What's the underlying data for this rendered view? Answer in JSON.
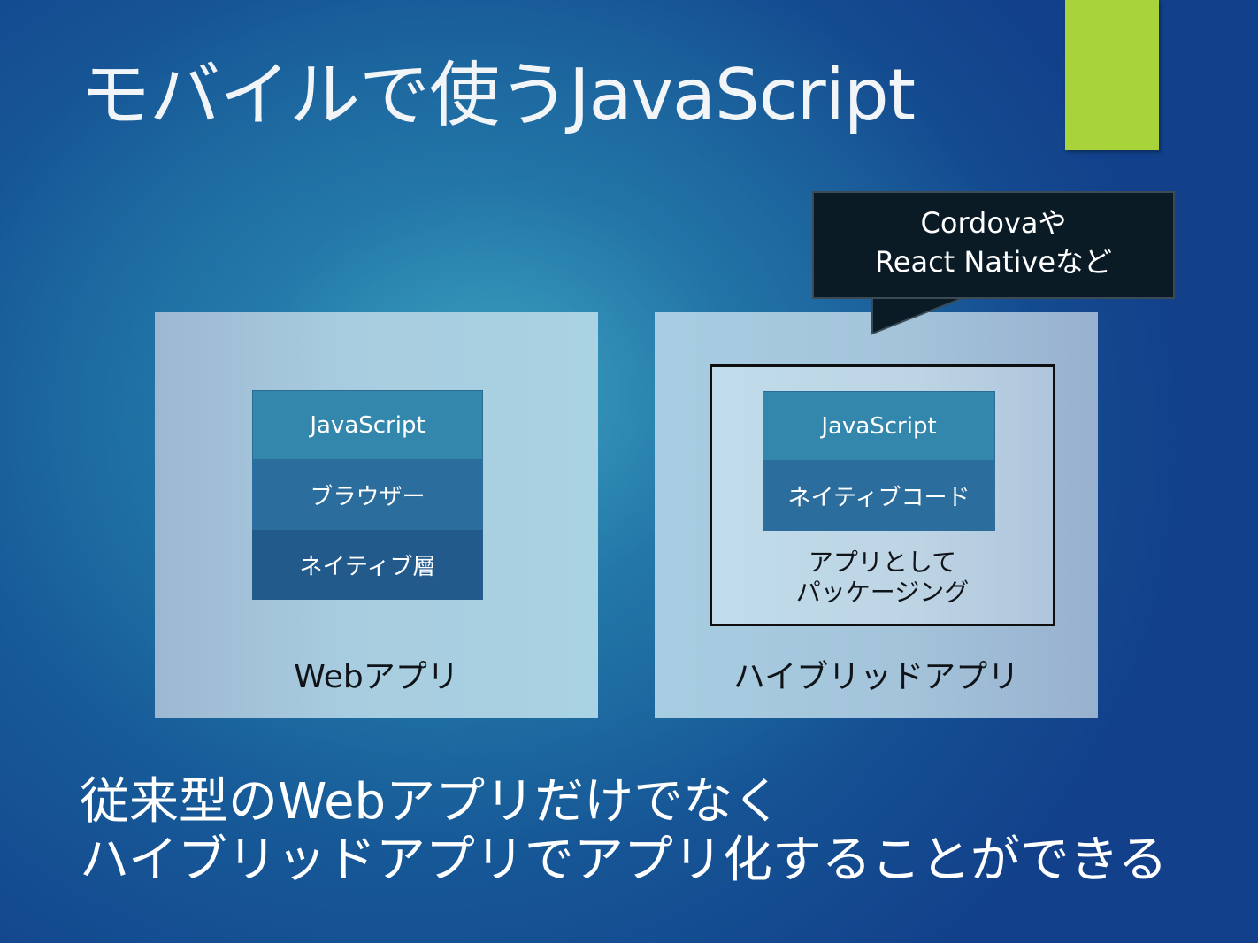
{
  "title": "モバイルで使うJavaScript",
  "colors": {
    "accent_bar": "#a8d33a",
    "callout_bg": "#0a1b26",
    "stack_js": "#3386ac",
    "stack_middle": "#2b6e9d",
    "stack_native": "#225a8c"
  },
  "callout": {
    "line1": "Cordovaや",
    "line2": "React Nativeなど"
  },
  "web_app": {
    "label": "Webアプリ",
    "stack": [
      "JavaScript",
      "ブラウザー",
      "ネイティブ層"
    ]
  },
  "hybrid_app": {
    "label": "ハイブリッドアプリ",
    "stack": [
      "JavaScript",
      "ネイティブコード"
    ],
    "package_label_line1": "アプリとして",
    "package_label_line2": "パッケージング"
  },
  "footer": {
    "line1": "従来型のWebアプリだけでなく",
    "line2": "ハイブリッドアプリでアプリ化することができる"
  }
}
